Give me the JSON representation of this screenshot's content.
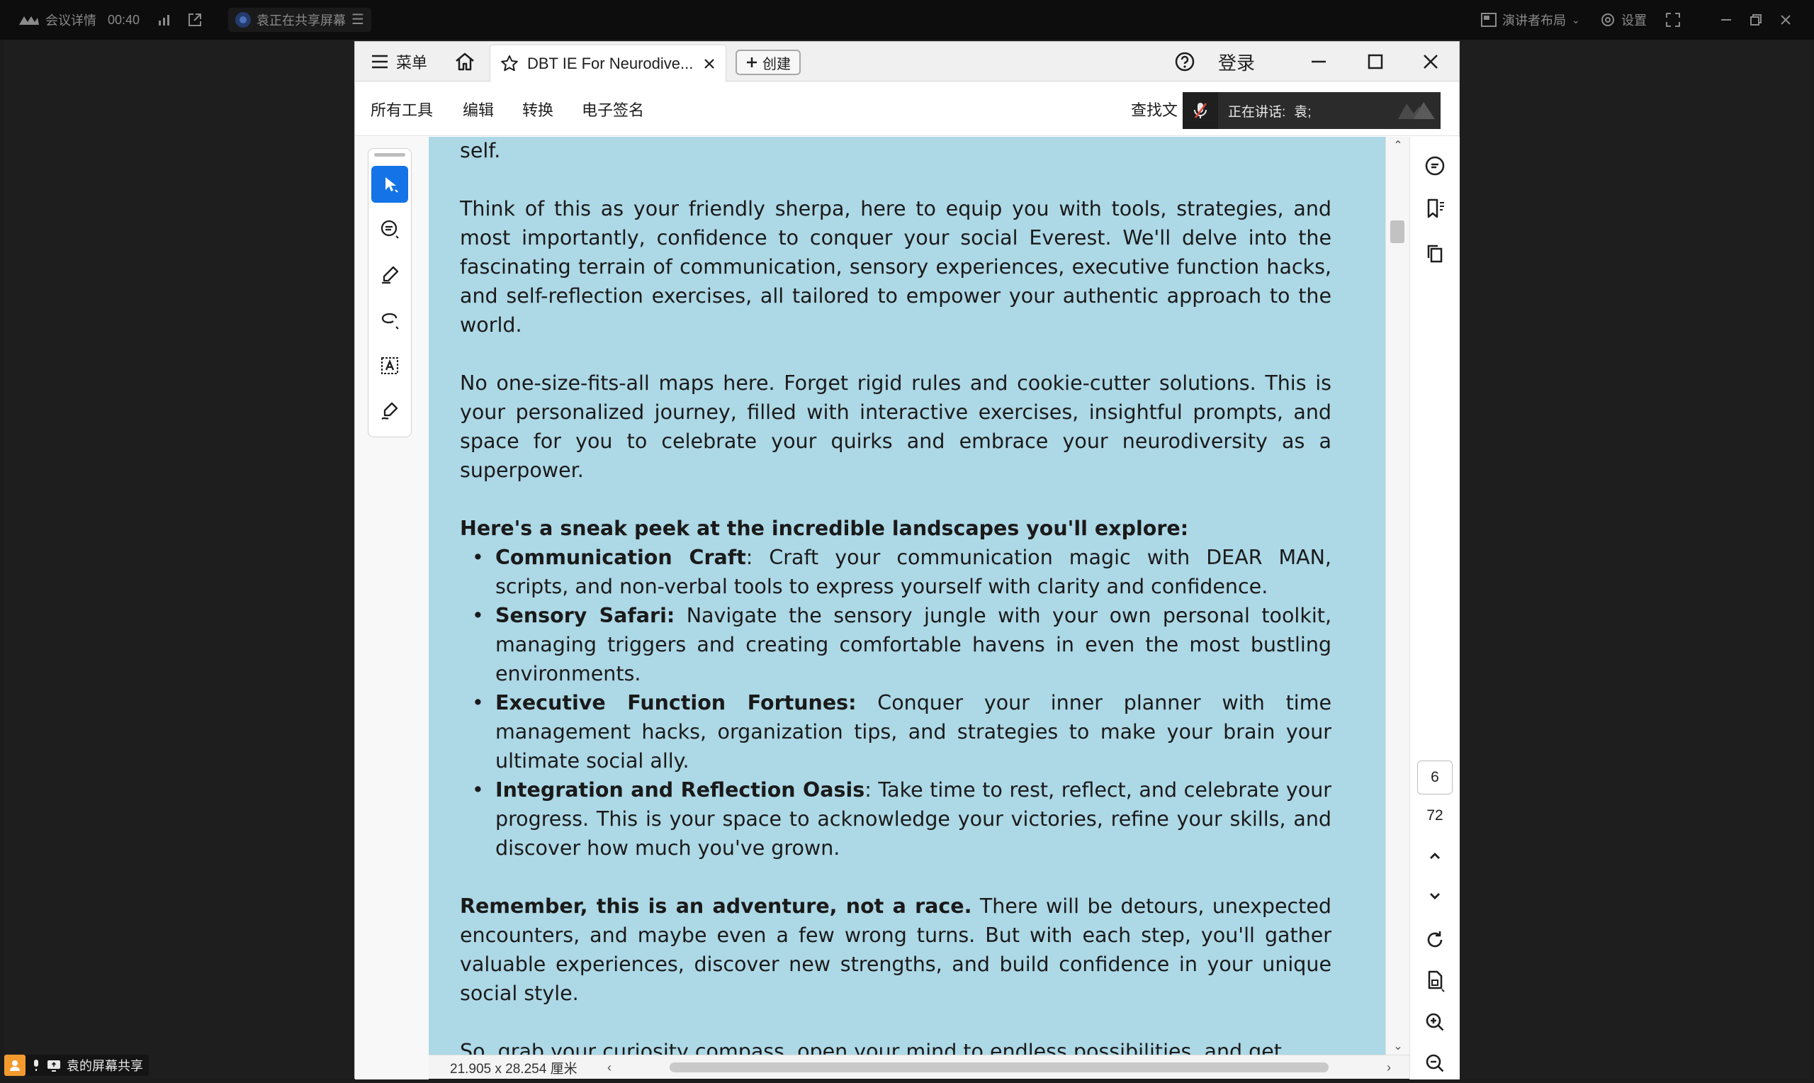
{
  "meeting": {
    "details": "会议详情",
    "timer": "00:40",
    "sharing_status": "袁正在共享屏幕",
    "layout_label": "演讲者布局",
    "settings_label": "设置"
  },
  "window": {
    "menu_label": "菜单",
    "tab_title": "DBT IE For Neurodive...",
    "create_label": "创建",
    "login_label": "登录"
  },
  "menubar": {
    "items": [
      "所有工具",
      "编辑",
      "转换",
      "电子签名"
    ],
    "find_label": "查找文"
  },
  "speaking": {
    "label": "正在讲话:",
    "name": "袁;"
  },
  "document": {
    "p0": "self.",
    "p1": "Think of this as your friendly sherpa, here to equip you with tools, strategies, and most importantly, confidence to conquer your social Everest. We'll delve into the fascinating terrain of communication, sensory experiences, executive function hacks, and self-reflection exercises, all tailored to empower your authentic approach to the world.",
    "p2": "No one-size-fits-all maps here. Forget rigid rules and cookie-cutter solutions. This is your personalized journey, filled with interactive exercises, insightful prompts, and space for you to celebrate your quirks and embrace your neurodiversity as a superpower.",
    "list_heading": "Here's a sneak peek at the incredible landscapes you'll explore:",
    "bullets": [
      {
        "title": "Communication Craft",
        "text": ": Craft your communication magic with DEAR MAN, scripts, and non-verbal tools to express yourself with clarity and confidence."
      },
      {
        "title": "Sensory Safari:",
        "text": " Navigate the sensory jungle with your own personal toolkit, managing triggers and creating comfortable havens in even the most bustling environments."
      },
      {
        "title": "Executive Function Fortunes:",
        "text": " Conquer your inner planner with time management hacks, organization tips, and strategies to make your brain your ultimate social ally."
      },
      {
        "title": "Integration and Reflection Oasis",
        "text": ": Take time to rest, reflect, and celebrate your progress. This is your space to acknowledge your victories, refine your skills, and discover how much you've grown."
      }
    ],
    "p3_bold": "Remember, this is an adventure, not a race.",
    "p3_rest": " There will be detours, unexpected encounters, and maybe even a few wrong turns. But with each step, you'll gather valuable experiences, discover new strengths, and build confidence in your unique social style.",
    "p4": "So, grab your curiosity compass, open your mind to endless possibilities, and get"
  },
  "status": {
    "page_size": "21.905 x 28.254 厘米"
  },
  "nav": {
    "current_page": "6",
    "total_pages": "72"
  },
  "share_indicator": {
    "label": "袁的屏幕共享"
  },
  "colors": {
    "page_background": "#add8e6",
    "accent": "#1473e6",
    "meeting_bar": "#0d0d0d"
  }
}
